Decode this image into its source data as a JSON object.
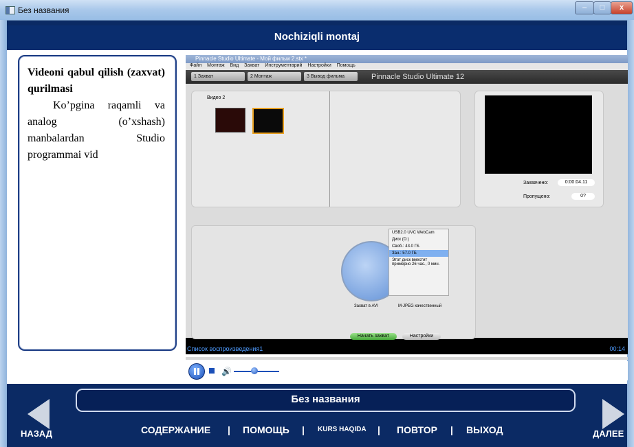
{
  "window": {
    "title": "Без названия",
    "minimize": "–",
    "maximize": "□",
    "close": "x"
  },
  "header": {
    "title": "Nochiziqli montaj"
  },
  "text": {
    "title_line1": "Videoni qabul qilish (zaxvat)",
    "title_line2": "qurilmasi",
    "body": "Ko’pgina raqamli va analog (o’xshash) manbalardan Studio programmai vid"
  },
  "video": {
    "app_title": "Pinnacle Studio Ultimate - Мой фильм 2.stx *",
    "menu": [
      "Файл",
      "Монтаж",
      "Вид",
      "Захват",
      "Инструментарий",
      "Настройки",
      "Помощь"
    ],
    "tabs": [
      "1 Захват",
      "2 Монтаж",
      "3 Вывод фильма"
    ],
    "brand": "Pinnacle Studio Ultimate 12",
    "album_label": "Видео 2",
    "captured_label": "Захвачено:",
    "captured_value": "0:00:04.11",
    "dropped_label": "Пропущено:",
    "dropped_value": "0?",
    "device": "USB2.0 UVC WebCam",
    "disk": "Диск (D:)",
    "free_label": "Своб.:",
    "free_value": "43.0 ГБ",
    "used_label": "Зан.:",
    "used_value": "57.0 ГБ",
    "disk_note": "Этот диск вместит примерно 26 час., 0 мин.",
    "capture_mode": "Захват в AVI",
    "quality": "M-JPEG качественный",
    "start_capture": "Начать захват",
    "settings": "Настройки",
    "playlist": "Список воспроизведения1",
    "time": "00:14"
  },
  "player": {
    "volume_level": 0.45
  },
  "footer": {
    "title": "Без названия",
    "back": "НАЗАД",
    "next": "ДАЛЕЕ",
    "menu": [
      "СОДЕРЖАНИЕ",
      "ПОМОЩЬ",
      "KURS HAQIDA",
      "ПОВТОР",
      "ВЫХОД"
    ],
    "separator": "|"
  }
}
